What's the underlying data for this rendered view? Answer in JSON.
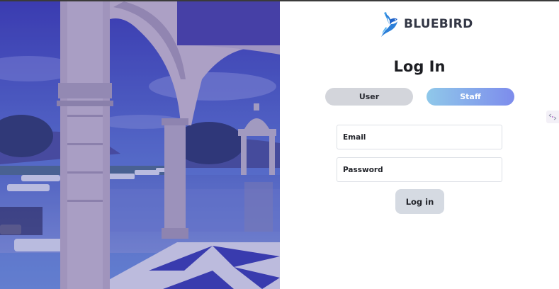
{
  "brand": {
    "name": "BLUEBIRD",
    "logo_icon": "bluebird-logo-icon",
    "color": "#2b7fd9"
  },
  "login": {
    "title": "Log In",
    "roles": [
      {
        "label": "User",
        "selected": false
      },
      {
        "label": "Staff",
        "selected": true
      }
    ],
    "email_placeholder": "Email",
    "password_placeholder": "Password",
    "submit_label": "Log in"
  },
  "hero": {
    "description_icon": "palace-pool-image",
    "tint": "#3a35a8"
  },
  "colors": {
    "accent_from": "#8fc8ea",
    "accent_to": "#7d8cec",
    "inactive": "#d3d5db",
    "button": "#d5dae2"
  },
  "extension": {
    "icon": "extension-icon"
  }
}
